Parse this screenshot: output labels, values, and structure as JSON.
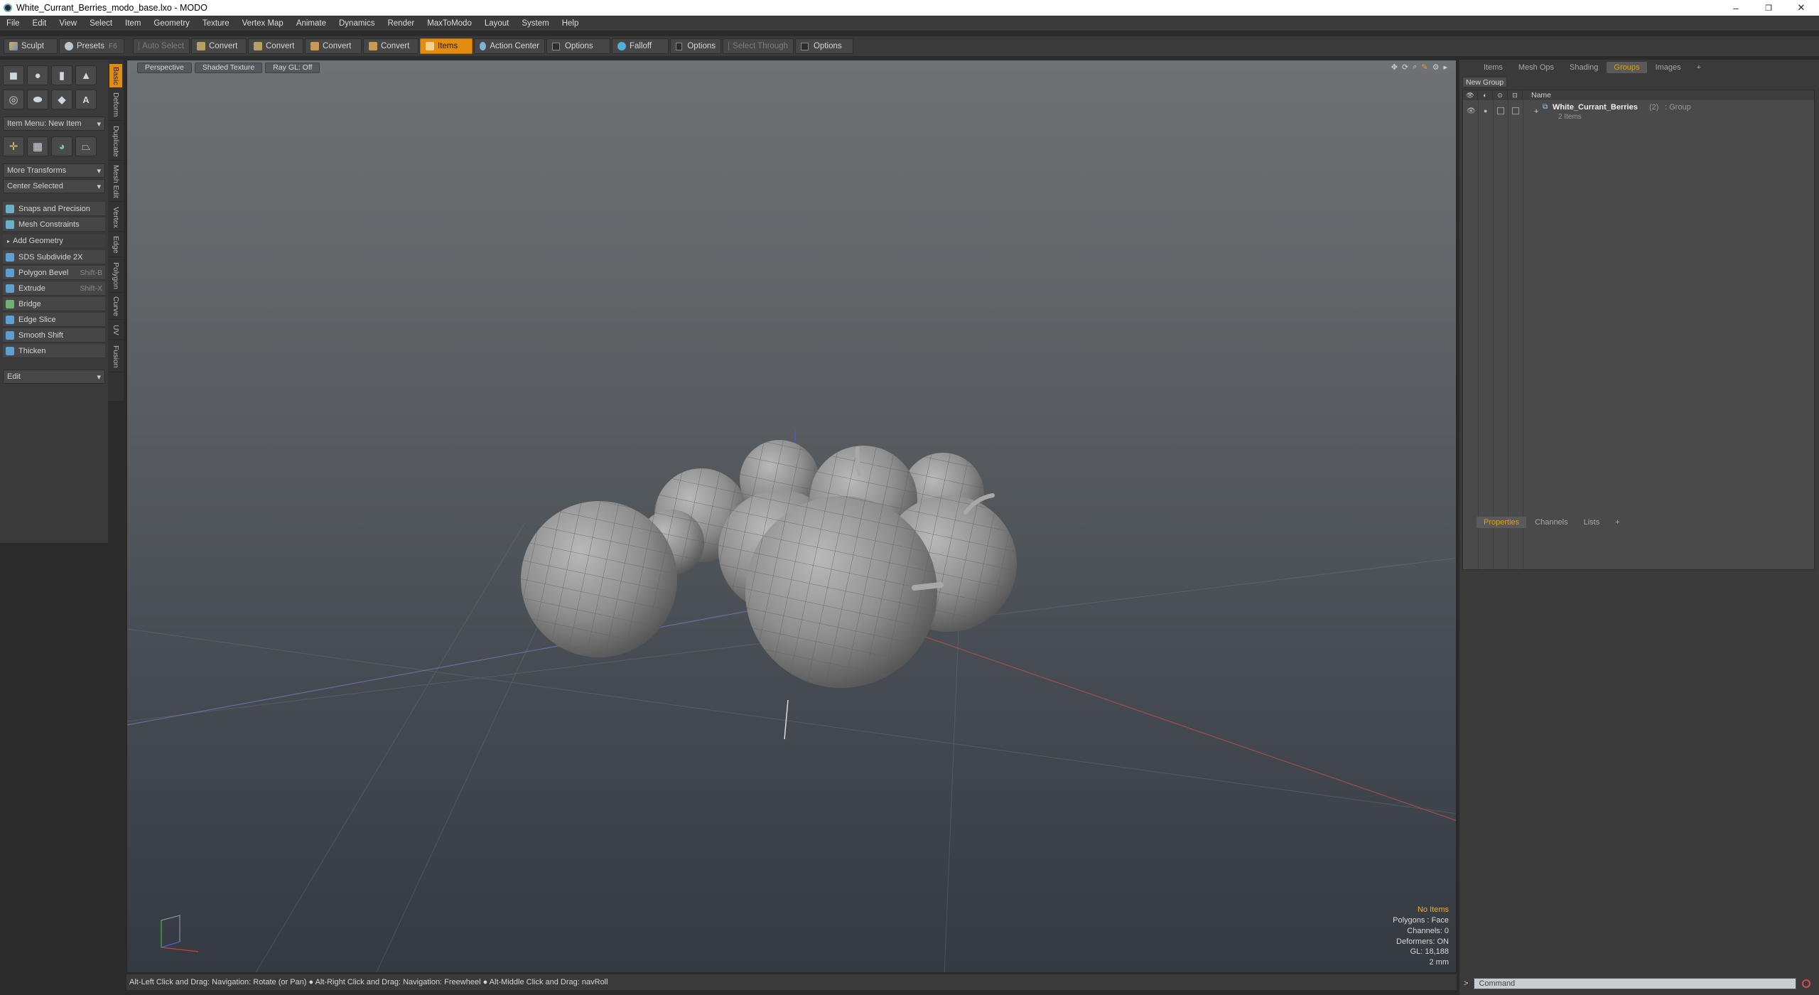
{
  "window": {
    "title": "White_Currant_Berries_modo_base.lxo - MODO",
    "minimize": "–",
    "maximize": "❐",
    "close": "✕"
  },
  "menu": [
    "File",
    "Edit",
    "View",
    "Select",
    "Item",
    "Geometry",
    "Texture",
    "Vertex Map",
    "Animate",
    "Dynamics",
    "Render",
    "MaxToModo",
    "Layout",
    "System",
    "Help"
  ],
  "toolbar": {
    "sculpt": "Sculpt",
    "presets": "Presets",
    "presets_key": "F6",
    "auto_select": "Auto Select",
    "convert": "Convert",
    "items": "Items",
    "action_center": "Action Center",
    "options": "Options",
    "falloff": "Falloff",
    "select_through": "Select Through"
  },
  "left": {
    "item_menu": "Item Menu: New Item",
    "more_transforms": "More Transforms",
    "center_selected": "Center Selected",
    "snaps": "Snaps and Precision",
    "mesh_constraints": "Mesh Constraints",
    "add_geometry": "Add Geometry",
    "tools": [
      {
        "label": "SDS Subdivide 2X",
        "shortcut": ""
      },
      {
        "label": "Polygon Bevel",
        "shortcut": "Shift-B"
      },
      {
        "label": "Extrude",
        "shortcut": "Shift-X"
      },
      {
        "label": "Bridge",
        "shortcut": ""
      },
      {
        "label": "Edge Slice",
        "shortcut": ""
      },
      {
        "label": "Smooth Shift",
        "shortcut": ""
      },
      {
        "label": "Thicken",
        "shortcut": ""
      }
    ],
    "edit": "Edit",
    "vtabs": [
      "Basic",
      "Deform",
      "Duplicate",
      "Mesh Edit",
      "Vertex",
      "Edge",
      "Polygon",
      "Curve",
      "UV",
      "Fusion"
    ]
  },
  "viewport": {
    "perspective": "Perspective",
    "shading": "Shaded Texture",
    "raygl": "Ray GL: Off",
    "hud": {
      "no_items": "No Items",
      "polygons": "Polygons : Face",
      "channels": "Channels: 0",
      "deformers": "Deformers: ON",
      "gl": "GL: 18,188",
      "scale": "2 mm"
    }
  },
  "status": "Alt-Left Click and Drag: Navigation: Rotate (or Pan) ● Alt-Right Click and Drag: Navigation: Freewheel ● Alt-Middle Click and Drag: navRoll",
  "right": {
    "tabs": [
      "Items",
      "Mesh Ops",
      "Shading",
      "Groups",
      "Images"
    ],
    "add_tab": "+",
    "new_group": "New Group",
    "col_name": "Name",
    "group_name": "White_Currant_Berries",
    "group_count": "(2)",
    "group_type": ": Group",
    "group_items": "2 Items",
    "prop_tabs": [
      "Properties",
      "Channels",
      "Lists"
    ],
    "command_placeholder": "Command"
  }
}
